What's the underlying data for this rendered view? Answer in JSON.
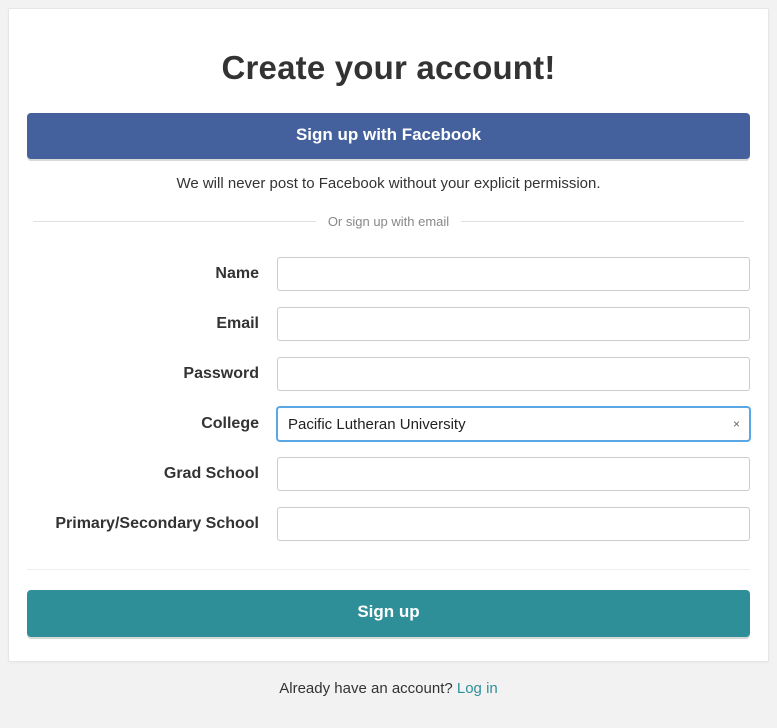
{
  "title": "Create your account!",
  "facebook_button": "Sign up with Facebook",
  "facebook_note": "We will never post to Facebook without your explicit permission.",
  "separator_text": "Or sign up with email",
  "fields": {
    "name": {
      "label": "Name",
      "value": ""
    },
    "email": {
      "label": "Email",
      "value": ""
    },
    "password": {
      "label": "Password",
      "value": ""
    },
    "college": {
      "label": "College",
      "value": "Pacific Lutheran University"
    },
    "grad": {
      "label": "Grad School",
      "value": ""
    },
    "k12": {
      "label": "Primary/Secondary School",
      "value": ""
    }
  },
  "clear_glyph": "×",
  "signup_button": "Sign up",
  "footer": {
    "text": "Already have an account? ",
    "link": "Log in"
  }
}
